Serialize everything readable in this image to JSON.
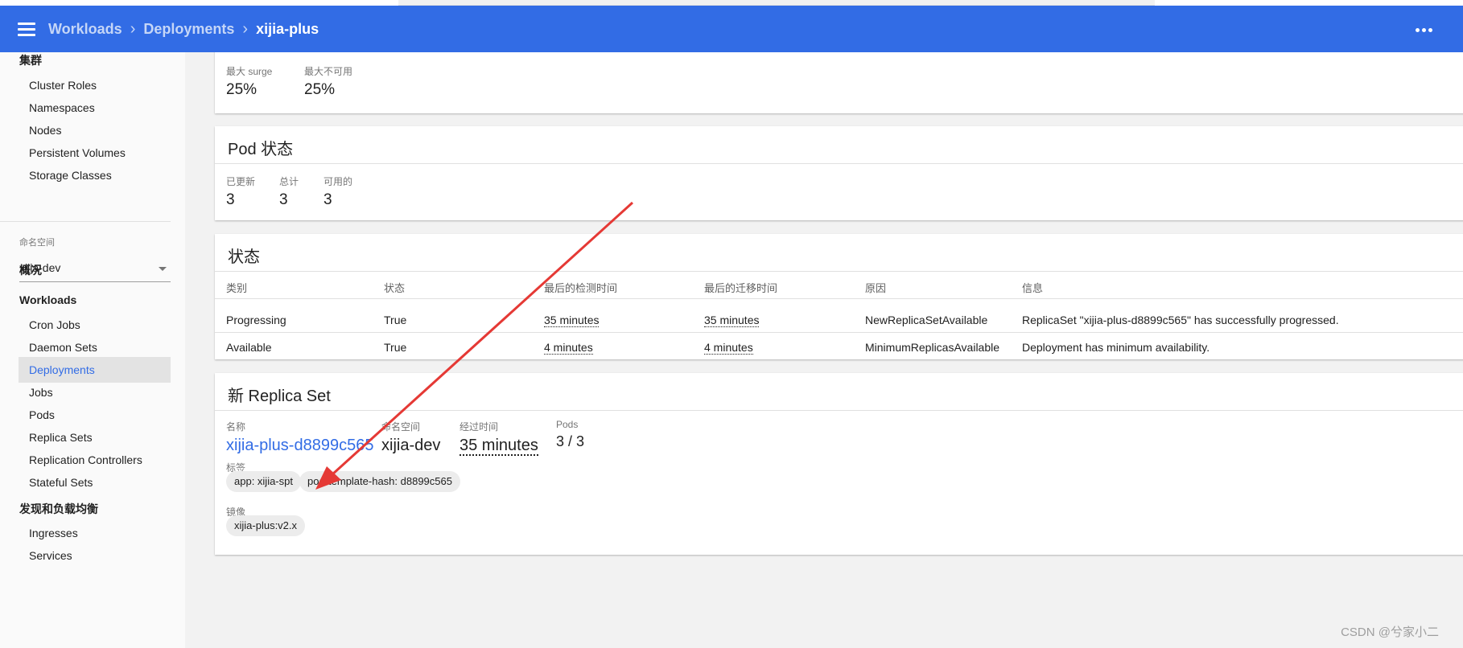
{
  "header": {
    "breadcrumbs": [
      "Workloads",
      "Deployments",
      "xijia-plus"
    ],
    "menu_icon": "menu-icon",
    "more_icon": "more-horizontal-icon",
    "bar_color": "#326ce5"
  },
  "sidebar": {
    "cluster_section": "集群",
    "cluster_items": [
      "Cluster Roles",
      "Namespaces",
      "Nodes",
      "Persistent Volumes",
      "Storage Classes"
    ],
    "namespace_label": "命名空间",
    "namespace_value": "xijia-dev",
    "overview": "概况",
    "workloads_section": "Workloads",
    "workload_items": [
      "Cron Jobs",
      "Daemon Sets",
      "Deployments",
      "Jobs",
      "Pods",
      "Replica Sets",
      "Replication Controllers",
      "Stateful Sets"
    ],
    "active_item": "Deployments",
    "discovery_section": "发现和负载均衡",
    "discovery_items": [
      "Ingresses",
      "Services"
    ]
  },
  "strategy": {
    "max_surge_label": "最大 surge",
    "max_surge_value": "25%",
    "max_unavailable_label": "最大不可用",
    "max_unavailable_value": "25%"
  },
  "pod_status": {
    "title": "Pod 状态",
    "updated_label": "已更新",
    "updated_value": "3",
    "total_label": "总计",
    "total_value": "3",
    "available_label": "可用的",
    "available_value": "3"
  },
  "conditions": {
    "title": "状态",
    "columns": [
      "类别",
      "状态",
      "最后的检测时间",
      "最后的迁移时间",
      "原因",
      "信息"
    ],
    "rows": [
      [
        "Progressing",
        "True",
        "35 minutes",
        "35 minutes",
        "NewReplicaSetAvailable",
        "ReplicaSet \"xijia-plus-d8899c565\" has successfully progressed."
      ],
      [
        "Available",
        "True",
        "4 minutes",
        "4 minutes",
        "MinimumReplicasAvailable",
        "Deployment has minimum availability."
      ]
    ]
  },
  "replica_set": {
    "title": "新 Replica Set",
    "name_label": "名称",
    "name_value": "xijia-plus-d8899c565",
    "namespace_label": "命名空间",
    "namespace_value": "xijia-dev",
    "age_label": "经过时间",
    "age_value": "35 minutes",
    "pods_label": "Pods",
    "pods_value": "3 / 3",
    "labels_label": "标签",
    "labels": [
      "app: xijia-spt",
      "pod-template-hash: d8899c565"
    ],
    "images_label": "镜像",
    "images": [
      "xijia-plus:v2.x"
    ]
  },
  "watermark": "CSDN @兮家小二",
  "annotation_color": "#e53935"
}
